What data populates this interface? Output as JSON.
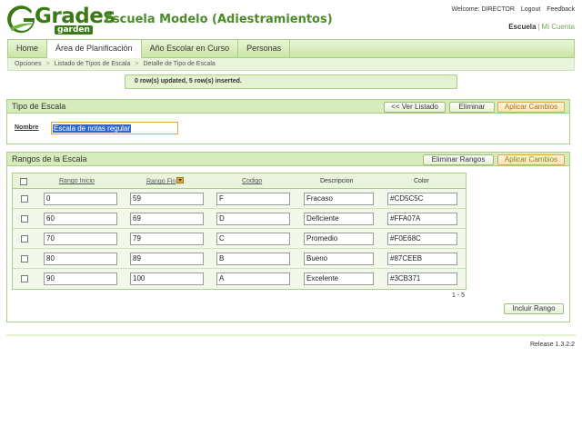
{
  "header": {
    "logo_text": "Grades",
    "logo_sub": "garden",
    "app_title": "Escuela Modelo (Adiestramientos)",
    "welcome": "Welcome: DIRECTOR",
    "logout": "Logout",
    "feedback": "Feedback",
    "school_current": "Escuela",
    "school_separator": "|",
    "school_other": "Mi Cuenta"
  },
  "nav": {
    "items": [
      {
        "label": "Home"
      },
      {
        "label": "Área de Planificación"
      },
      {
        "label": "Año Escolar en Curso"
      },
      {
        "label": "Personas"
      }
    ],
    "active_index": 1
  },
  "breadcrumb": {
    "items": [
      "Opciones",
      "Listado de Tipos de Escala",
      "Detalle de Tipo de Escala"
    ],
    "separator": ">"
  },
  "message": "0 row(s) updated, 5 row(s) inserted.",
  "tipo_panel": {
    "title": "Tipo de Escala",
    "buttons": {
      "ver_listado": "<< Ver Listado",
      "eliminar": "Eliminar",
      "aplicar": "Aplicar Cambios"
    },
    "nombre_label": "Nombre",
    "nombre_value": "Escala de notas regular"
  },
  "rangos_panel": {
    "title": "Rangos de la Escala",
    "buttons": {
      "eliminar_rangos": "Eliminar Rangos",
      "aplicar": "Aplicar Cambios",
      "incluir": "Incluir Rango"
    },
    "columns": {
      "rango_inicio": "Rango Inicio",
      "rango_fin": "Rango Fin",
      "codigo": "Codigo",
      "descripcion": "Descripcion",
      "color": "Color"
    },
    "rows": [
      {
        "inicio": "0",
        "fin": "59",
        "codigo": "F",
        "descripcion": "Fracaso",
        "color": "#CD5C5C"
      },
      {
        "inicio": "60",
        "fin": "69",
        "codigo": "D",
        "descripcion": "Deficiente",
        "color": "#FFA07A"
      },
      {
        "inicio": "70",
        "fin": "79",
        "codigo": "C",
        "descripcion": "Promedio",
        "color": "#F0E68C"
      },
      {
        "inicio": "80",
        "fin": "89",
        "codigo": "B",
        "descripcion": "Bueno",
        "color": "#87CEEB"
      },
      {
        "inicio": "90",
        "fin": "100",
        "codigo": "A",
        "descripcion": "Excelente",
        "color": "#3CB371"
      }
    ],
    "pager": "1 - 5"
  },
  "footer": {
    "release": "Release 1.3.2.2"
  },
  "colors": {
    "brand_green": "#3a7a16",
    "title_green": "#4c8a2a",
    "panel_head": "#d7ecbd",
    "border": "#a9cf84",
    "accent_orange": "#e0a840"
  },
  "icons": {
    "logo": "g-swoosh-logo",
    "sort": "sort-desc-icon"
  }
}
